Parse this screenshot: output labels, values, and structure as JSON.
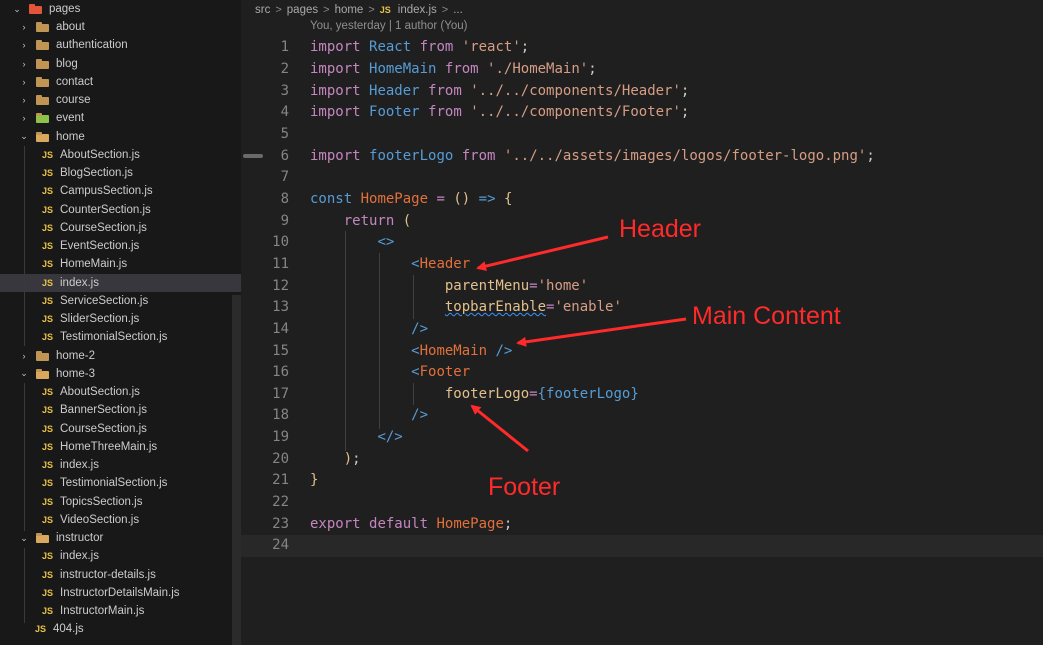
{
  "explorer": {
    "root": "pages",
    "items": [
      {
        "label": "about",
        "kind": "folder",
        "state": "closed",
        "depth": 1
      },
      {
        "label": "authentication",
        "kind": "folder",
        "state": "closed",
        "depth": 1
      },
      {
        "label": "blog",
        "kind": "folder",
        "state": "closed",
        "depth": 1
      },
      {
        "label": "contact",
        "kind": "folder",
        "state": "closed",
        "depth": 1
      },
      {
        "label": "course",
        "kind": "folder",
        "state": "closed",
        "depth": 1
      },
      {
        "label": "event",
        "kind": "folder",
        "state": "closed",
        "depth": 1
      },
      {
        "label": "home",
        "kind": "folder",
        "state": "open",
        "depth": 1
      },
      {
        "label": "AboutSection.js",
        "kind": "file",
        "depth": 2
      },
      {
        "label": "BlogSection.js",
        "kind": "file",
        "depth": 2
      },
      {
        "label": "CampusSection.js",
        "kind": "file",
        "depth": 2
      },
      {
        "label": "CounterSection.js",
        "kind": "file",
        "depth": 2
      },
      {
        "label": "CourseSection.js",
        "kind": "file",
        "depth": 2
      },
      {
        "label": "EventSection.js",
        "kind": "file",
        "depth": 2
      },
      {
        "label": "HomeMain.js",
        "kind": "file",
        "depth": 2
      },
      {
        "label": "index.js",
        "kind": "file",
        "depth": 2,
        "selected": true
      },
      {
        "label": "ServiceSection.js",
        "kind": "file",
        "depth": 2
      },
      {
        "label": "SliderSection.js",
        "kind": "file",
        "depth": 2
      },
      {
        "label": "TestimonialSection.js",
        "kind": "file",
        "depth": 2
      },
      {
        "label": "home-2",
        "kind": "folder",
        "state": "closed",
        "depth": 1
      },
      {
        "label": "home-3",
        "kind": "folder",
        "state": "open",
        "depth": 1
      },
      {
        "label": "AboutSection.js",
        "kind": "file",
        "depth": 2
      },
      {
        "label": "BannerSection.js",
        "kind": "file",
        "depth": 2
      },
      {
        "label": "CourseSection.js",
        "kind": "file",
        "depth": 2
      },
      {
        "label": "HomeThreeMain.js",
        "kind": "file",
        "depth": 2
      },
      {
        "label": "index.js",
        "kind": "file",
        "depth": 2
      },
      {
        "label": "TestimonialSection.js",
        "kind": "file",
        "depth": 2
      },
      {
        "label": "TopicsSection.js",
        "kind": "file",
        "depth": 2
      },
      {
        "label": "VideoSection.js",
        "kind": "file",
        "depth": 2
      },
      {
        "label": "instructor",
        "kind": "folder",
        "state": "open",
        "depth": 1
      },
      {
        "label": "index.js",
        "kind": "file",
        "depth": 2
      },
      {
        "label": "instructor-details.js",
        "kind": "file",
        "depth": 2
      },
      {
        "label": "InstructorDetailsMain.js",
        "kind": "file",
        "depth": 2
      },
      {
        "label": "InstructorMain.js",
        "kind": "file",
        "depth": 2
      },
      {
        "label": "404.js",
        "kind": "file",
        "depth": 1
      }
    ]
  },
  "file_icon_text": "JS",
  "breadcrumb": [
    "src",
    "pages",
    "home",
    "index.js",
    "..."
  ],
  "blame": "You, yesterday | 1 author (You)",
  "code": {
    "current_line": 24,
    "lines": [
      [
        [
          "kw",
          "import"
        ],
        [
          "plain",
          " "
        ],
        [
          "id",
          "React"
        ],
        [
          "plain",
          " "
        ],
        [
          "kw",
          "from"
        ],
        [
          "plain",
          " "
        ],
        [
          "str",
          "'react'"
        ],
        [
          "pun",
          ";"
        ]
      ],
      [
        [
          "kw",
          "import"
        ],
        [
          "plain",
          " "
        ],
        [
          "id",
          "HomeMain"
        ],
        [
          "plain",
          " "
        ],
        [
          "kw",
          "from"
        ],
        [
          "plain",
          " "
        ],
        [
          "str",
          "'./HomeMain'"
        ],
        [
          "pun",
          ";"
        ]
      ],
      [
        [
          "kw",
          "import"
        ],
        [
          "plain",
          " "
        ],
        [
          "id",
          "Header"
        ],
        [
          "plain",
          " "
        ],
        [
          "kw",
          "from"
        ],
        [
          "plain",
          " "
        ],
        [
          "str",
          "'../../components/Header'"
        ],
        [
          "pun",
          ";"
        ]
      ],
      [
        [
          "kw",
          "import"
        ],
        [
          "plain",
          " "
        ],
        [
          "id",
          "Footer"
        ],
        [
          "plain",
          " "
        ],
        [
          "kw",
          "from"
        ],
        [
          "plain",
          " "
        ],
        [
          "str",
          "'../../components/Footer'"
        ],
        [
          "pun",
          ";"
        ]
      ],
      [],
      [
        [
          "kw",
          "import"
        ],
        [
          "plain",
          " "
        ],
        [
          "id",
          "footerLogo"
        ],
        [
          "plain",
          " "
        ],
        [
          "kw",
          "from"
        ],
        [
          "plain",
          " "
        ],
        [
          "str",
          "'../../assets/images/logos/footer-logo.png'"
        ],
        [
          "pun",
          ";"
        ]
      ],
      [],
      [
        [
          "id",
          "const"
        ],
        [
          "plain",
          " "
        ],
        [
          "fn",
          "HomePage"
        ],
        [
          "plain",
          " "
        ],
        [
          "op",
          "="
        ],
        [
          "plain",
          " "
        ],
        [
          "brace",
          "()"
        ],
        [
          "plain",
          " "
        ],
        [
          "id",
          "=>"
        ],
        [
          "plain",
          " "
        ],
        [
          "brace",
          "{"
        ]
      ],
      [
        [
          "plain",
          "    "
        ],
        [
          "kw",
          "return"
        ],
        [
          "plain",
          " "
        ],
        [
          "brace",
          "("
        ]
      ],
      [
        [
          "plain",
          "        "
        ],
        [
          "tag",
          "<>"
        ]
      ],
      [
        [
          "plain",
          "            "
        ],
        [
          "tag",
          "<"
        ],
        [
          "fn",
          "Header"
        ]
      ],
      [
        [
          "plain",
          "                "
        ],
        [
          "attr",
          "parentMenu"
        ],
        [
          "op",
          "="
        ],
        [
          "str",
          "'home'"
        ]
      ],
      [
        [
          "plain",
          "                "
        ],
        [
          "attr",
          "topbarEnable",
          "squiggle"
        ],
        [
          "op",
          "="
        ],
        [
          "str",
          "'enable'"
        ]
      ],
      [
        [
          "plain",
          "            "
        ],
        [
          "tag",
          "/>"
        ]
      ],
      [
        [
          "plain",
          "            "
        ],
        [
          "tag",
          "<"
        ],
        [
          "fn",
          "HomeMain"
        ],
        [
          "plain",
          " "
        ],
        [
          "tag",
          "/>"
        ]
      ],
      [
        [
          "plain",
          "            "
        ],
        [
          "tag",
          "<"
        ],
        [
          "fn",
          "Footer"
        ]
      ],
      [
        [
          "plain",
          "                "
        ],
        [
          "attr",
          "footerLogo"
        ],
        [
          "op",
          "="
        ],
        [
          "id",
          "{"
        ],
        [
          "id",
          "footerLogo"
        ],
        [
          "id",
          "}"
        ]
      ],
      [
        [
          "plain",
          "            "
        ],
        [
          "tag",
          "/>"
        ]
      ],
      [
        [
          "plain",
          "        "
        ],
        [
          "tag",
          "</>"
        ]
      ],
      [
        [
          "plain",
          "    "
        ],
        [
          "brace",
          ")"
        ],
        [
          "pun",
          ";"
        ]
      ],
      [
        [
          "brace",
          "}"
        ]
      ],
      [],
      [
        [
          "kw",
          "export"
        ],
        [
          "plain",
          " "
        ],
        [
          "kw",
          "default"
        ],
        [
          "plain",
          " "
        ],
        [
          "fn",
          "HomePage"
        ],
        [
          "pun",
          ";"
        ]
      ],
      []
    ]
  },
  "annotations": {
    "header": "Header",
    "main_content": "Main Content",
    "footer": "Footer"
  },
  "colors": {
    "annotation_red": "#ff2a2a",
    "selection_bg": "#37373d",
    "editor_bg": "#1f1f1f",
    "sidebar_bg": "#181818"
  }
}
